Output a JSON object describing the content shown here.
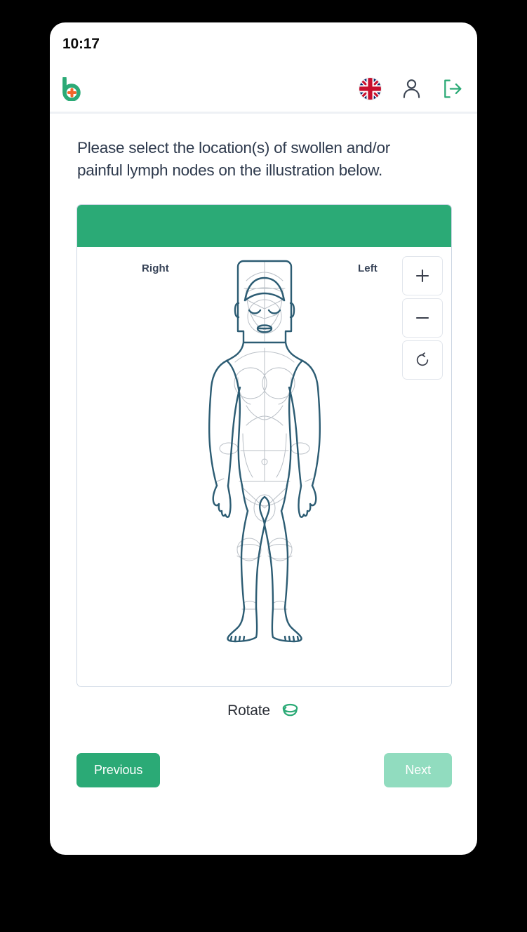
{
  "status_bar": {
    "time": "10:17"
  },
  "header": {
    "logo_name": "b-health-logo",
    "language_flag": "uk-flag-icon",
    "account_icon": "user-account-icon",
    "logout_icon": "logout-icon"
  },
  "question": {
    "line1": "Please select the location(s) of swollen and/or",
    "line2": "painful lymph nodes on the illustration below."
  },
  "illustration": {
    "topbar_color": "#2BAA76",
    "label_right": "Right",
    "label_left": "Left",
    "zoom_in_label": "+",
    "zoom_out_label": "−",
    "reset_icon": "rotate-reset-icon",
    "figure_description": "female-body-front-view",
    "outline_color": "#2C5C73",
    "detail_color": "#b9bfc6"
  },
  "rotate": {
    "label": "Rotate",
    "icon": "rotate-3d-icon",
    "icon_color": "#2BAA76"
  },
  "footer": {
    "previous_label": "Previous",
    "next_label": "Next",
    "previous_color": "#2BAA76",
    "next_color": "#91dcbf"
  }
}
